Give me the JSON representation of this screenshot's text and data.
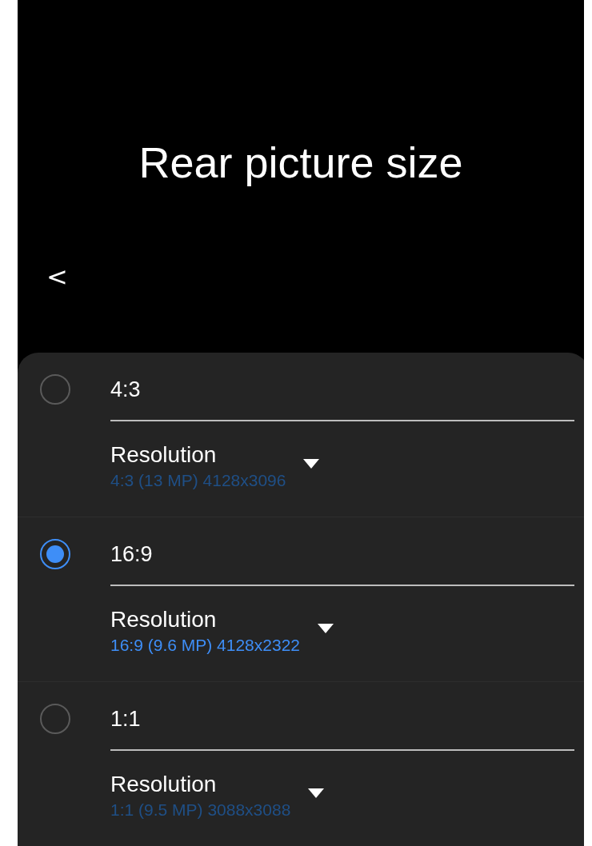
{
  "header": {
    "title": "Rear picture size",
    "back": "<"
  },
  "options": [
    {
      "ratio": "4:3",
      "selected": false,
      "label": "Resolution",
      "value": "4:3 (13 MP) 4128x3096"
    },
    {
      "ratio": "16:9",
      "selected": true,
      "label": "Resolution",
      "value": "16:9 (9.6 MP) 4128x2322"
    },
    {
      "ratio": "1:1",
      "selected": false,
      "label": "Resolution",
      "value": "1:1 (9.5 MP) 3088x3088"
    }
  ]
}
